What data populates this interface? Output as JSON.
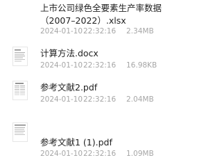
{
  "files": [
    {
      "name_line1": "上市公司绿色全要素生产率数据",
      "name_line2": "（2007–2022）.xlsx",
      "date": "2024-01-10",
      "time": "22:32:16",
      "size": "2.34MB",
      "icon": "spreadsheet-icon"
    },
    {
      "name_line1": "计算方法.docx",
      "date": "2024-01-10",
      "time": "22:32:16",
      "size": "16.98KB",
      "icon": "document-icon"
    },
    {
      "name_line1": "参考文献2.pdf",
      "date": "2024-01-10",
      "time": "22:32:16",
      "size": "2.04MB",
      "icon": "pdf-icon"
    },
    {
      "name_line1": "参考文献1 (1).pdf",
      "date": "2024-01-10",
      "time": "22:32:16",
      "size": "1.09MB",
      "icon": "pdf-icon"
    }
  ]
}
